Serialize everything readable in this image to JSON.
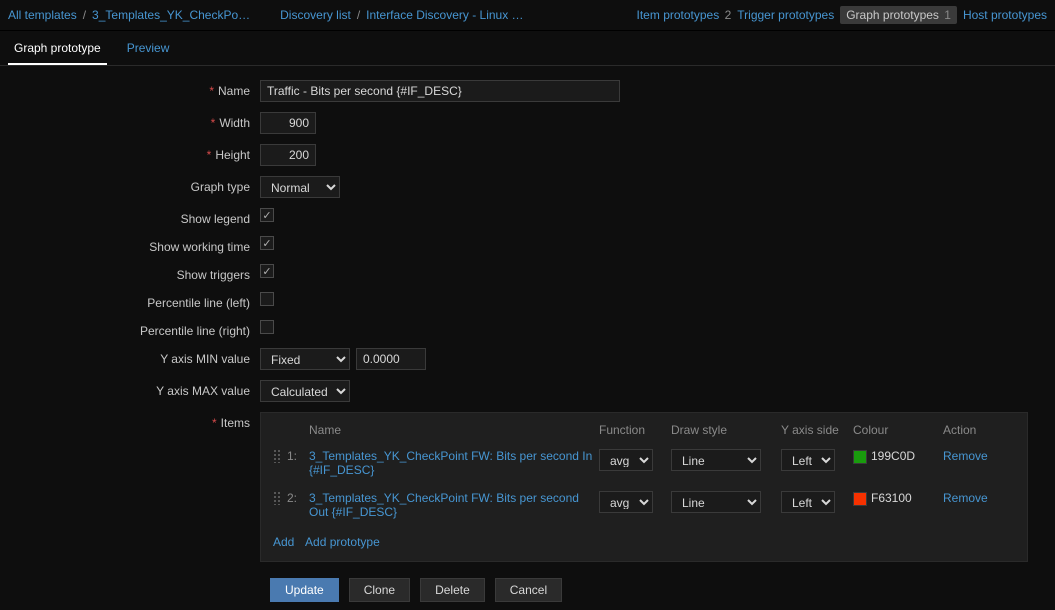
{
  "crumbs": {
    "all_templates": "All templates",
    "template": "3_Templates_YK_CheckPo…",
    "discovery_list": "Discovery list",
    "rule": "Interface Discovery - Linux …"
  },
  "nav": {
    "item_proto": "Item prototypes",
    "item_proto_count": "2",
    "trigger_proto": "Trigger prototypes",
    "graph_proto": "Graph prototypes",
    "graph_proto_count": "1",
    "host_proto": "Host prototypes"
  },
  "tabs": {
    "graph_proto": "Graph prototype",
    "preview": "Preview"
  },
  "labels": {
    "name": "Name",
    "width": "Width",
    "height": "Height",
    "graph_type": "Graph type",
    "show_legend": "Show legend",
    "show_working_time": "Show working time",
    "show_triggers": "Show triggers",
    "percentile_left": "Percentile line (left)",
    "percentile_right": "Percentile line (right)",
    "y_min": "Y axis MIN value",
    "y_max": "Y axis MAX value",
    "items": "Items"
  },
  "values": {
    "name": "Traffic - Bits per second {#IF_DESC}",
    "width": "900",
    "height": "200",
    "graph_type": "Normal",
    "show_legend": true,
    "show_working_time": true,
    "show_triggers": true,
    "percentile_left": false,
    "percentile_right": false,
    "y_min_mode": "Fixed",
    "y_min_val": "0.0000",
    "y_max_mode": "Calculated"
  },
  "items_headers": {
    "name": "Name",
    "function": "Function",
    "draw": "Draw style",
    "axis": "Y axis side",
    "colour": "Colour",
    "action": "Action"
  },
  "items": [
    {
      "idx": "1:",
      "name": "3_Templates_YK_CheckPoint FW: Bits per second In {#IF_DESC}",
      "function": "avg",
      "draw": "Line",
      "axis": "Left",
      "colour_hex": "199C0D",
      "colour_css": "#199C0D",
      "action": "Remove"
    },
    {
      "idx": "2:",
      "name": "3_Templates_YK_CheckPoint FW: Bits per second Out {#IF_DESC}",
      "function": "avg",
      "draw": "Line",
      "axis": "Left",
      "colour_hex": "F63100",
      "colour_css": "#F63100",
      "action": "Remove"
    }
  ],
  "links": {
    "add": "Add",
    "add_proto": "Add prototype"
  },
  "buttons": {
    "update": "Update",
    "clone": "Clone",
    "delete": "Delete",
    "cancel": "Cancel"
  }
}
